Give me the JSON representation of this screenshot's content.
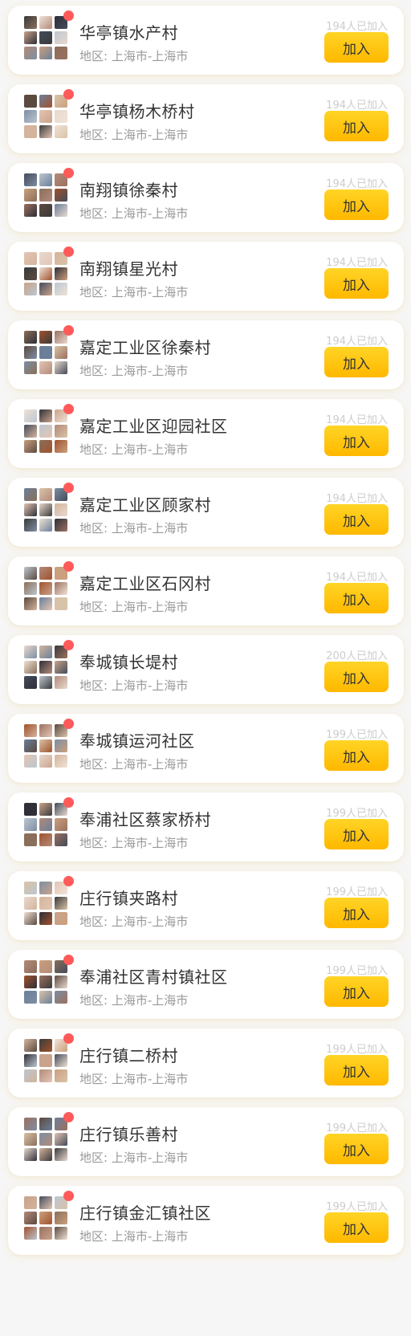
{
  "colors": {
    "accent": "#ffc107",
    "badge_dot": "#ff5a5a",
    "name_text": "#333333",
    "sub_text": "#999999",
    "count_text": "#cccccc"
  },
  "communities": [
    {
      "name": "华亭镇水产村",
      "region": "地区: 上海市-上海市",
      "members": "194人已加入",
      "join_label": "加入"
    },
    {
      "name": "华亭镇杨木桥村",
      "region": "地区: 上海市-上海市",
      "members": "194人已加入",
      "join_label": "加入"
    },
    {
      "name": "南翔镇徐秦村",
      "region": "地区: 上海市-上海市",
      "members": "194人已加入",
      "join_label": "加入"
    },
    {
      "name": "南翔镇星光村",
      "region": "地区: 上海市-上海市",
      "members": "194人已加入",
      "join_label": "加入"
    },
    {
      "name": "嘉定工业区徐秦村",
      "region": "地区: 上海市-上海市",
      "members": "194人已加入",
      "join_label": "加入"
    },
    {
      "name": "嘉定工业区迎园社区",
      "region": "地区: 上海市-上海市",
      "members": "194人已加入",
      "join_label": "加入"
    },
    {
      "name": "嘉定工业区顾家村",
      "region": "地区: 上海市-上海市",
      "members": "194人已加入",
      "join_label": "加入"
    },
    {
      "name": "嘉定工业区石冈村",
      "region": "地区: 上海市-上海市",
      "members": "194人已加入",
      "join_label": "加入"
    },
    {
      "name": "奉城镇长堤村",
      "region": "地区: 上海市-上海市",
      "members": "200人已加入",
      "join_label": "加入"
    },
    {
      "name": "奉城镇运河社区",
      "region": "地区: 上海市-上海市",
      "members": "199人已加入",
      "join_label": "加入"
    },
    {
      "name": "奉浦社区蔡家桥村",
      "region": "地区: 上海市-上海市",
      "members": "199人已加入",
      "join_label": "加入"
    },
    {
      "name": "庄行镇夹路村",
      "region": "地区: 上海市-上海市",
      "members": "199人已加入",
      "join_label": "加入"
    },
    {
      "name": "奉浦社区青村镇社区",
      "region": "地区: 上海市-上海市",
      "members": "199人已加入",
      "join_label": "加入"
    },
    {
      "name": "庄行镇二桥村",
      "region": "地区: 上海市-上海市",
      "members": "199人已加入",
      "join_label": "加入"
    },
    {
      "name": "庄行镇乐善村",
      "region": "地区: 上海市-上海市",
      "members": "199人已加入",
      "join_label": "加入"
    },
    {
      "name": "庄行镇金汇镇社区",
      "region": "地区: 上海市-上海市",
      "members": "199人已加入",
      "join_label": "加入"
    }
  ]
}
